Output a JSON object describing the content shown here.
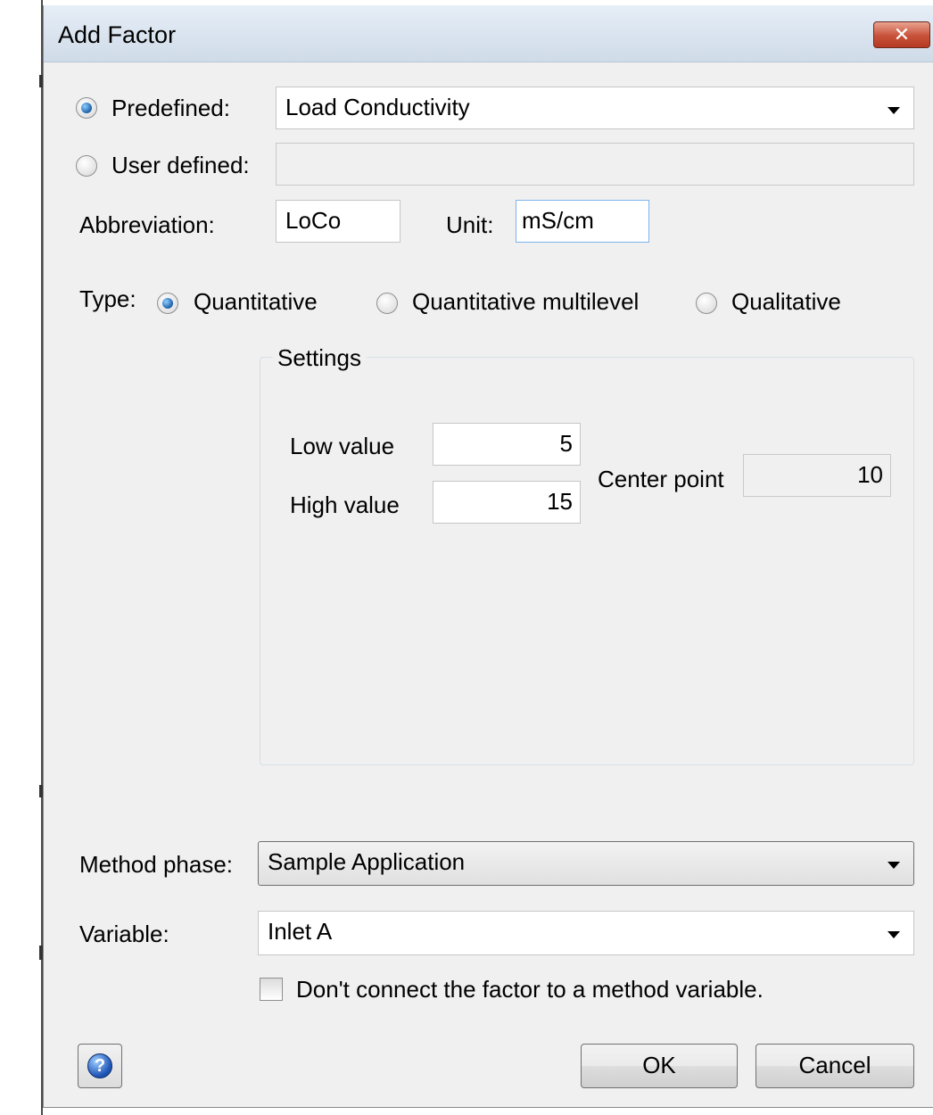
{
  "window": {
    "title": "Add Factor",
    "close_glyph": "✕"
  },
  "factor": {
    "predefined_label": "Predefined:",
    "predefined_value": "Load Conductivity",
    "user_defined_label": "User defined:",
    "user_defined_value": "",
    "selected_source": "predefined"
  },
  "abbreviation": {
    "label": "Abbreviation:",
    "value": "LoCo"
  },
  "unit": {
    "label": "Unit:",
    "value": "mS/cm"
  },
  "type": {
    "label": "Type:",
    "options": [
      "Quantitative",
      "Quantitative multilevel",
      "Qualitative"
    ],
    "selected": "Quantitative"
  },
  "settings": {
    "legend": "Settings",
    "low_label": "Low value",
    "low_value": "5",
    "high_label": "High value",
    "high_value": "15",
    "center_label": "Center point",
    "center_value": "10"
  },
  "method_phase": {
    "label": "Method phase:",
    "value": "Sample Application"
  },
  "variable": {
    "label": "Variable:",
    "value": "Inlet A"
  },
  "dont_connect": {
    "label": "Don't connect the factor to a method variable.",
    "checked": false
  },
  "buttons": {
    "help_glyph": "?",
    "ok": "OK",
    "cancel": "Cancel"
  },
  "icons": [
    "close-icon",
    "dropdown-arrow-icon",
    "help-icon"
  ],
  "colors": {
    "titlebar": "#dce6f1",
    "close_button": "#c8513a",
    "dialog_bg": "#f0f0f0",
    "radio_dot": "#1c5fa8"
  }
}
